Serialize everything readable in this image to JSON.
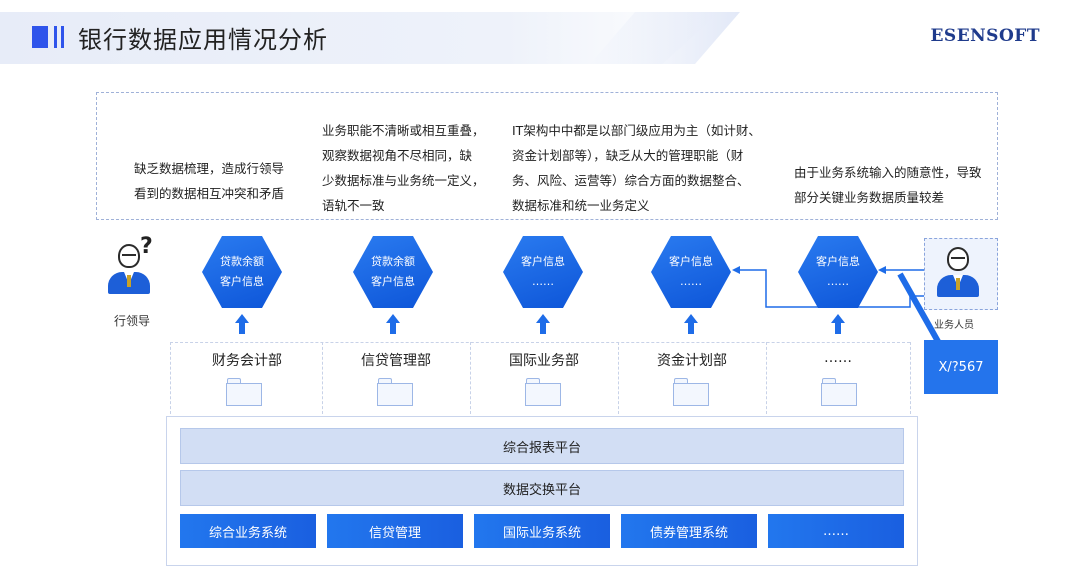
{
  "header": {
    "title": "银行数据应用情况分析",
    "brand": "ESENSOFT"
  },
  "problems": [
    {
      "lines": [
        "缺乏数据梳理，造成行领导",
        "看到的数据相互冲突和矛盾"
      ]
    },
    {
      "lines": [
        "业务职能不清晰或相互重叠，",
        "观察数据视角不尽相同，缺",
        "少数据标准与业务统一定义，",
        "语轨不一致"
      ]
    },
    {
      "lines": [
        "IT架构中中都是以部门级应用为主（如计财、",
        "资金计划部等），缺乏从大的管理职能（财",
        "务、风险、运营等）综合方面的数据整合、",
        "数据标准和统一业务定义"
      ]
    },
    {
      "lines": [
        "由于业务系统输入的随意性，导致",
        "部分关键业务数据质量较差"
      ]
    }
  ],
  "hexagons": [
    {
      "line1": "贷款余额",
      "line2": "客户信息"
    },
    {
      "line1": "贷款余额",
      "line2": "客户信息"
    },
    {
      "line1": "客户信息",
      "line2": "……"
    },
    {
      "line1": "客户信息",
      "line2": "……"
    },
    {
      "line1": "客户信息",
      "line2": "……"
    }
  ],
  "people": {
    "leader_label": "行领导",
    "leader_mark": "?",
    "staff_label": "业务人员"
  },
  "x_box": "X/?567",
  "departments": [
    "财务会计部",
    "信贷管理部",
    "国际业务部",
    "资金计划部",
    "……"
  ],
  "platforms": [
    "综合报表平台",
    "数据交换平台"
  ],
  "systems": [
    "综合业务系统",
    "信贷管理",
    "国际业务系统",
    "债券管理系统",
    "……"
  ],
  "colors": {
    "accent": "#2f54eb",
    "hexagon": "#1565e0",
    "system": "#2277ee",
    "platform": "#d2def4"
  }
}
